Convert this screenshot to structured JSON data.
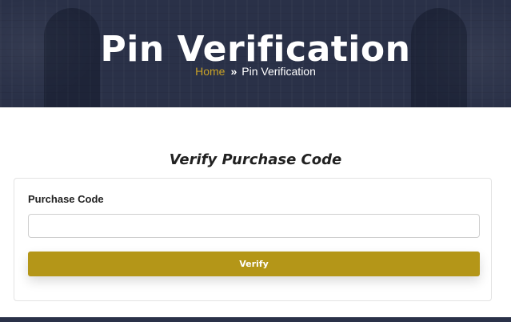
{
  "colors": {
    "hero_background": "#2a3148",
    "accent": "#c9a227",
    "button": "#b49618"
  },
  "header": {
    "title": "Pin Verification",
    "breadcrumb": {
      "home": "Home",
      "separator": "»",
      "separator_icon": "double-chevron-right-icon",
      "current": "Pin Verification"
    }
  },
  "main": {
    "heading": "Verify Purchase Code",
    "form": {
      "purchase_code_label": "Purchase Code",
      "purchase_code_value": "",
      "purchase_code_placeholder": "",
      "submit_label": "Verify"
    }
  }
}
